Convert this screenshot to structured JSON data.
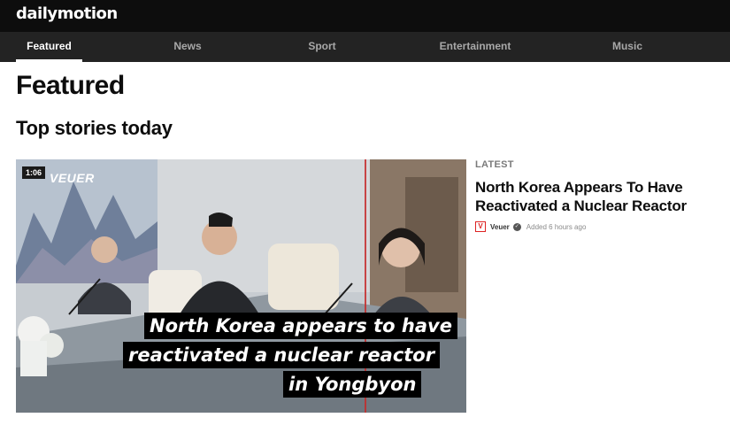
{
  "header": {
    "logo": "dailymotion"
  },
  "nav": {
    "items": [
      {
        "label": "Featured",
        "active": true
      },
      {
        "label": "News",
        "active": false
      },
      {
        "label": "Sport",
        "active": false
      },
      {
        "label": "Entertainment",
        "active": false
      },
      {
        "label": "Music",
        "active": false
      }
    ]
  },
  "page": {
    "title": "Featured",
    "section_title": "Top stories today"
  },
  "video": {
    "duration": "1:06",
    "brand": "VEUER",
    "captions": [
      "North Korea appears to have",
      "reactivated a nuclear reactor",
      "in Yongbyon"
    ]
  },
  "sidebar": {
    "badge": "LATEST",
    "headline": "North Korea Appears To Have Reactivated a Nuclear Reactor",
    "channel_logo": "V",
    "channel": "Veuer",
    "verified_icon": "check-circle-icon",
    "added": "Added 6 hours ago"
  },
  "colors": {
    "topbar": "#0d0d0d",
    "navbar": "#232323",
    "accent": "#d22222"
  }
}
